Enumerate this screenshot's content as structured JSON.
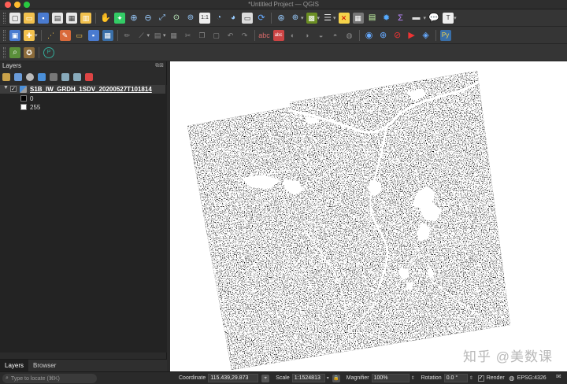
{
  "window": {
    "title": "*Untitled Project — QGIS"
  },
  "toolbar1": {
    "icons": [
      "new-project",
      "open-project",
      "save-project",
      "save-as",
      "print-layout",
      "layout-manager",
      "pan-tool",
      "pan-to-selection",
      "zoom-in",
      "zoom-out",
      "zoom-full",
      "zoom-to-selection",
      "zoom-to-layer",
      "zoom-to-native",
      "zoom-last",
      "zoom-next",
      "new-map-view",
      "refresh",
      "identify",
      "select-features",
      "attribute-table",
      "field-calculator",
      "statistics",
      "measure",
      "map-tips",
      "annotation"
    ]
  },
  "toolbar2": {
    "icons": [
      "data-source-manager",
      "new-geopackage-layer",
      "digitize",
      "current-edits",
      "toggle-editing",
      "save-edits",
      "add-feature",
      "vertex-tool",
      "delete-selected",
      "cut",
      "copy",
      "paste",
      "undo",
      "redo",
      "label-tools",
      "plugins",
      "web-map",
      "processing",
      "python-console"
    ]
  },
  "layers_panel": {
    "title": "Layers",
    "layer": {
      "name": "S1B_IW_GRDH_1SDV_20200527T101814",
      "checked": true,
      "legend": [
        {
          "label": "0",
          "color": "#000000"
        },
        {
          "label": "255",
          "color": "#ffffff"
        }
      ]
    },
    "tabs": [
      {
        "label": "Layers",
        "active": true
      },
      {
        "label": "Browser",
        "active": false
      }
    ]
  },
  "canvas": {
    "background": "#ffffff",
    "raster_color": "#000000",
    "watermark": "知乎 @美数课"
  },
  "statusbar": {
    "locator_placeholder": "Type to locate (⌘K)",
    "coordinate_label": "Coordinate",
    "coordinate_value": "115.439,29.873",
    "scale_label": "Scale",
    "scale_value": "1:1524813",
    "magnifier_label": "Magnifier",
    "magnifier_value": "100%",
    "rotation_label": "Rotation",
    "rotation_value": "0.0 °",
    "render_label": "Render",
    "render_checked": true,
    "crs_label": "EPSG:4326"
  }
}
